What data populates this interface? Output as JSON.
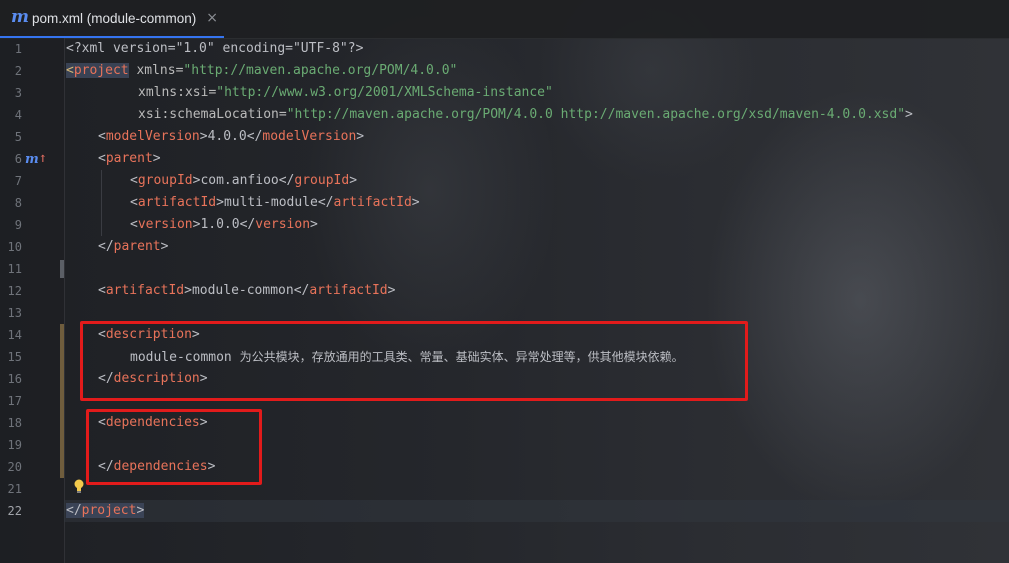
{
  "tab": {
    "icon": "m",
    "title": "pom.xml (module-common)",
    "close": "×"
  },
  "gutter": {
    "line_numbers": [
      "1",
      "2",
      "3",
      "4",
      "5",
      "6",
      "7",
      "8",
      "9",
      "10",
      "11",
      "12",
      "13",
      "14",
      "15",
      "16",
      "17",
      "18",
      "19",
      "20",
      "21",
      "22"
    ],
    "maven_marker": "m",
    "maven_marker_arrow": "↑"
  },
  "code": {
    "l1": {
      "decl": "<?xml version=\"1.0\" encoding=\"UTF-8\"?>"
    },
    "l2": {
      "open": "<",
      "tag": "project",
      "attr": " xmlns=",
      "val": "\"http://maven.apache.org/POM/4.0.0\""
    },
    "l3": {
      "attr": "xmlns:xsi=",
      "val": "\"http://www.w3.org/2001/XMLSchema-instance\""
    },
    "l4": {
      "attr": "xsi:schemaLocation=",
      "val": "\"http://maven.apache.org/POM/4.0.0 http://maven.apache.org/xsd/maven-4.0.0.xsd\"",
      "close": ">"
    },
    "l5": {
      "tag": "modelVersion",
      "text": "4.0.0"
    },
    "l6": {
      "tag": "parent"
    },
    "l7": {
      "tag": "groupId",
      "text": "com.anfioo"
    },
    "l8": {
      "tag": "artifactId",
      "text": "multi-module"
    },
    "l9": {
      "tag": "version",
      "text": "1.0.0"
    },
    "l10": {
      "tag": "parent"
    },
    "l12": {
      "tag": "artifactId",
      "text": "module-common"
    },
    "l14": {
      "tag": "description"
    },
    "l15": {
      "text_latin": "module-common ",
      "text_cjk": "为公共模块，存放通用的工具类、常量、基础实体、异常处理等，供其他模块依赖。"
    },
    "l16": {
      "tag": "description"
    },
    "l18": {
      "tag": "dependencies"
    },
    "l20": {
      "tag": "dependencies"
    },
    "l22": {
      "open": "</",
      "tag": "project",
      "close": ">"
    }
  },
  "colors": {
    "highlight_box": "#e21b1b",
    "tag_name": "#e8735a",
    "string": "#6aab73",
    "accent": "#3574f0"
  }
}
